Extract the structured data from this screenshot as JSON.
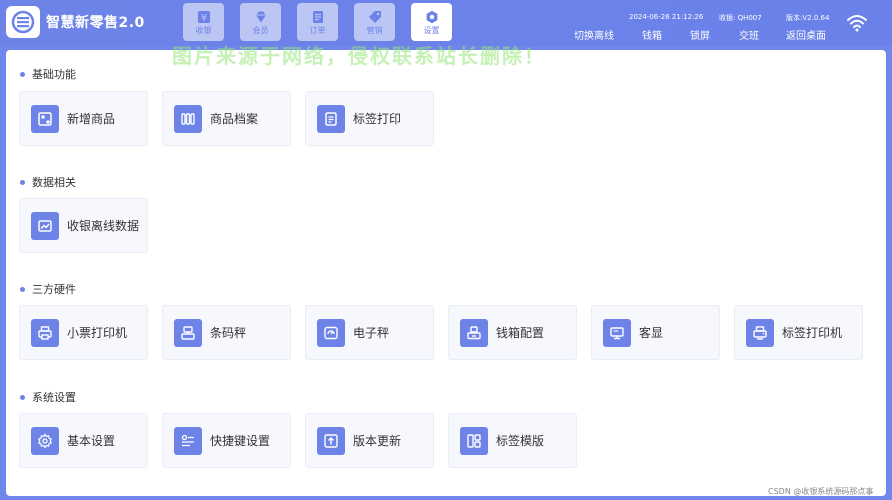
{
  "app": {
    "title": "智慧新零售2.0"
  },
  "nav_tabs": [
    {
      "label": "收银",
      "icon": "yen-icon",
      "active": false
    },
    {
      "label": "会员",
      "icon": "diamond-icon",
      "active": false
    },
    {
      "label": "订单",
      "icon": "order-icon",
      "active": false
    },
    {
      "label": "营销",
      "icon": "tag-icon",
      "active": false
    },
    {
      "label": "设置",
      "icon": "gear-icon",
      "active": true
    }
  ],
  "status": {
    "datetime": "2024-06-26 21:12:26",
    "cashier": "收银: QH007",
    "version": "版本:V2.0.64"
  },
  "header_actions": [
    "切换离线",
    "钱箱",
    "锁屏",
    "交班",
    "返回桌面"
  ],
  "watermark": "图片来源于网络，侵权联系站长删除！",
  "sections": [
    {
      "title": "基础功能",
      "items": [
        {
          "label": "新增商品",
          "icon": "add-product-icon"
        },
        {
          "label": "商品档案",
          "icon": "product-archive-icon"
        },
        {
          "label": "标签打印",
          "icon": "label-print-icon"
        }
      ]
    },
    {
      "title": "数据相关",
      "items": [
        {
          "label": "收银离线数据",
          "icon": "offline-data-icon"
        }
      ]
    },
    {
      "title": "三方硬件",
      "items": [
        {
          "label": "小票打印机",
          "icon": "receipt-printer-icon"
        },
        {
          "label": "条码秤",
          "icon": "barcode-scale-icon"
        },
        {
          "label": "电子秤",
          "icon": "electronic-scale-icon"
        },
        {
          "label": "钱箱配置",
          "icon": "cash-drawer-icon"
        },
        {
          "label": "客显",
          "icon": "customer-display-icon"
        },
        {
          "label": "标签打印机",
          "icon": "label-printer-icon"
        }
      ]
    },
    {
      "title": "系统设置",
      "items": [
        {
          "label": "基本设置",
          "icon": "settings-gear-icon"
        },
        {
          "label": "快捷键设置",
          "icon": "shortcut-icon"
        },
        {
          "label": "版本更新",
          "icon": "update-icon"
        },
        {
          "label": "标签模版",
          "icon": "template-icon"
        }
      ]
    }
  ],
  "footer": {
    "credit": "CSDN @收银系统源码那点事"
  },
  "colors": {
    "primary": "#6d83e8",
    "tile_bg": "#f6f8fd",
    "text": "#333333"
  }
}
